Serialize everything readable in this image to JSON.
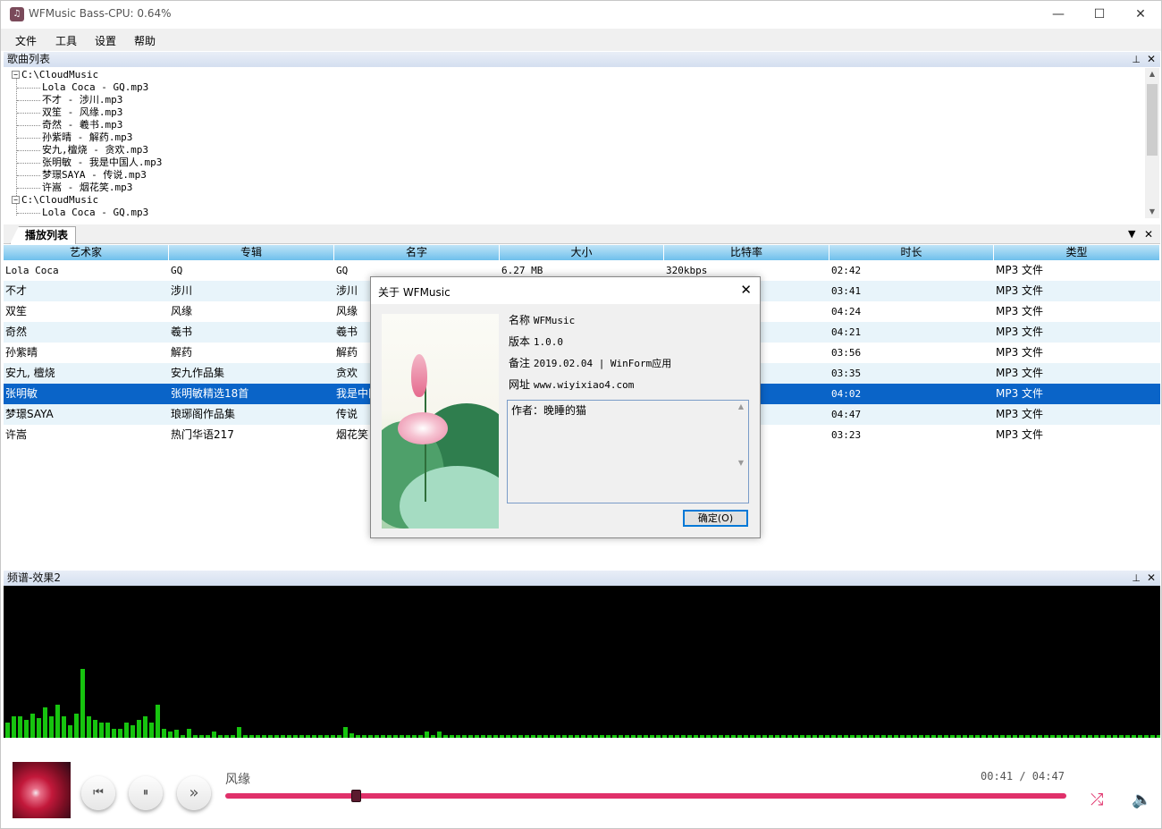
{
  "window": {
    "title": "WFMusic Bass-CPU: 0.64%",
    "minimize": "—",
    "maximize": "☐",
    "close": "✕"
  },
  "menu": {
    "items": [
      "文件",
      "工具",
      "设置",
      "帮助"
    ]
  },
  "song_list_panel": {
    "title": "歌曲列表",
    "pin": "⊥",
    "close": "✕",
    "tree": {
      "root": "C:\\CloudMusic",
      "files": [
        "Lola Coca - GQ.mp3",
        "不才 - 涉川.mp3",
        "双笙 - 风缘.mp3",
        "奇然 - 羲书.mp3",
        "孙紫晴 - 解药.mp3",
        "安九,檀烧 - 贪欢.mp3",
        "张明敏 - 我是中国人.mp3",
        "梦璟SAYA - 传说.mp3",
        "许嵩 - 烟花笑.mp3"
      ],
      "root2": "C:\\CloudMusic",
      "files2": [
        "Lola Coca - GQ.mp3"
      ]
    }
  },
  "playlist": {
    "tab": "播放列表",
    "dropdown": "▼",
    "close": "✕",
    "columns": [
      "艺术家",
      "专辑",
      "名字",
      "大小",
      "比特率",
      "时长",
      "类型"
    ],
    "rows": [
      [
        "Lola Coca",
        "GQ",
        "GQ",
        "6.27 MB",
        "320kbps",
        "02:42",
        "MP3 文件"
      ],
      [
        "不才",
        "涉川",
        "涉川",
        "",
        "",
        "03:41",
        "MP3 文件"
      ],
      [
        "双笙",
        "风缘",
        "风缘",
        "",
        "",
        "04:24",
        "MP3 文件"
      ],
      [
        "奇然",
        "羲书",
        "羲书",
        "",
        "",
        "04:21",
        "MP3 文件"
      ],
      [
        "孙紫晴",
        "解药",
        "解药",
        "",
        "",
        "03:56",
        "MP3 文件"
      ],
      [
        "安九, 檀烧",
        "安九作品集",
        "贪欢",
        "",
        "",
        "03:35",
        "MP3 文件"
      ],
      [
        "张明敏",
        "张明敏精选18首",
        "我是中国",
        "",
        "",
        "04:02",
        "MP3 文件"
      ],
      [
        "梦璟SAYA",
        "琅琊阁作品集",
        "传说",
        "",
        "",
        "04:47",
        "MP3 文件"
      ],
      [
        "许嵩",
        "热门华语217",
        "烟花笑",
        "",
        "",
        "03:23",
        "MP3 文件"
      ]
    ],
    "selected_row": 6
  },
  "spectrum_panel": {
    "title": "频谱-效果2",
    "pin": "⊥",
    "close": "✕",
    "bar_color": "#17c40f",
    "levels": [
      0.1,
      0.14,
      0.14,
      0.12,
      0.16,
      0.13,
      0.2,
      0.14,
      0.22,
      0.14,
      0.08,
      0.16,
      0.45,
      0.14,
      0.12,
      0.1,
      0.1,
      0.06,
      0.06,
      0.1,
      0.08,
      0.12,
      0.14,
      0.1,
      0.22,
      0.06,
      0.04,
      0.05,
      0.02,
      0.06,
      0.02,
      0.02,
      0.02,
      0.04,
      0.02,
      0.02,
      0.02,
      0.07,
      0.02,
      0.02,
      0.02,
      0.02,
      0.02,
      0.02,
      0.02,
      0.02,
      0.02,
      0.02,
      0.02,
      0.02,
      0.02,
      0.02,
      0.02,
      0.02,
      0.07,
      0.03,
      0.02,
      0.02,
      0.02,
      0.02,
      0.02,
      0.02,
      0.02,
      0.02,
      0.02,
      0.02,
      0.02,
      0.04,
      0.02,
      0.04,
      0.02,
      0.02,
      0.02,
      0.02,
      0.02,
      0.02,
      0.02,
      0.02,
      0.02,
      0.02,
      0.02,
      0.02,
      0.02,
      0.02,
      0.02,
      0.02,
      0.02,
      0.02,
      0.02,
      0.02,
      0.02,
      0.02,
      0.02,
      0.02,
      0.02,
      0.02,
      0.02,
      0.02,
      0.02,
      0.02,
      0.02,
      0.02,
      0.02,
      0.02,
      0.02,
      0.02,
      0.02,
      0.02,
      0.02,
      0.02,
      0.02,
      0.02,
      0.02,
      0.02,
      0.02,
      0.02,
      0.02,
      0.02,
      0.02,
      0.02,
      0.02,
      0.02,
      0.02,
      0.02,
      0.02,
      0.02,
      0.02,
      0.02,
      0.02,
      0.02,
      0.02,
      0.02,
      0.02,
      0.02,
      0.02,
      0.02,
      0.02,
      0.02,
      0.02,
      0.02,
      0.02,
      0.02,
      0.02,
      0.02,
      0.02,
      0.02,
      0.02,
      0.02,
      0.02,
      0.02,
      0.02,
      0.02,
      0.02,
      0.02,
      0.02,
      0.02,
      0.02,
      0.02,
      0.02,
      0.02,
      0.02,
      0.02,
      0.02,
      0.02,
      0.02,
      0.02,
      0.02,
      0.02,
      0.02,
      0.02,
      0.02,
      0.02,
      0.02,
      0.02,
      0.02,
      0.02,
      0.02,
      0.02,
      0.02,
      0.02,
      0.02,
      0.02,
      0.02,
      0.02,
      0.02,
      0.02,
      0.02,
      0.02,
      0.02,
      0.02,
      0.02,
      0.02,
      0.02,
      0.02,
      0.02,
      0.02,
      0.02,
      0.02,
      0.02,
      0.02,
      0.02,
      0.02
    ]
  },
  "player": {
    "song": "风缘",
    "time": "00:41 / 04:47",
    "progress": 0.155,
    "accent": "#e0306a",
    "prev_icon": "⏮",
    "pause_icon": "⏸",
    "next_icon": "»",
    "shuffle_icon": "⤮",
    "volume_icon": "🔈"
  },
  "about_dialog": {
    "title": "关于 WFMusic",
    "close": "✕",
    "name_label": "名称",
    "name_value": "WFMusic",
    "version_label": "版本",
    "version_value": "1.0.0",
    "note_label": "备注",
    "note_value": "2019.02.04 | WinForm应用",
    "url_label": "网址",
    "url_value": "www.wiyixiao4.com",
    "author_text": "作者：晚睡的猫",
    "ok_button": "确定(O)"
  }
}
